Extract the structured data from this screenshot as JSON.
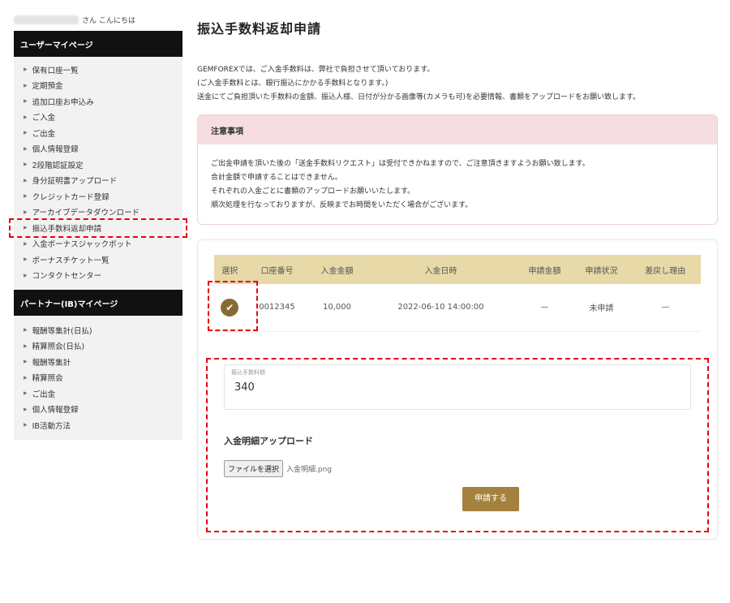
{
  "greeting": "さん こんにちは",
  "user_section": {
    "title": "ユーザーマイページ",
    "items": [
      "保有口座一覧",
      "定期預金",
      "追加口座お申込み",
      "ご入金",
      "ご出金",
      "個人情報登録",
      "2段階認証設定",
      "身分証明書アップロード",
      "クレジットカード登録",
      "アーカイブデータダウンロード",
      "振込手数料返却申請",
      "入金ボーナスジャックポット",
      "ボーナスチケット一覧",
      "コンタクトセンター"
    ]
  },
  "partner_section": {
    "title": "パートナー(IB)マイページ",
    "items": [
      "報酬等集計(日払)",
      "精算照会(日払)",
      "報酬等集計",
      "精算照会",
      "ご出金",
      "個人情報登録",
      "IB活動方法"
    ]
  },
  "page": {
    "title": "振込手数料返却申請",
    "intro": [
      "GEMFOREXでは、ご入金手数料は、弊社で負担させて頂いております。",
      "(ご入金手数料とは、銀行振込にかかる手数料となります。)",
      "送金にてご負担頂いた手数料の金額、振込人様、日付が分かる画像等(カメラも可)を必要情報、書類をアップロードをお願い致します。"
    ]
  },
  "notice": {
    "title": "注意事項",
    "lines": [
      "ご出金申請を頂いた後の「送金手数料リクエスト」は受付できかねますので、ご注意頂きますようお願い致します。",
      "合計金額で申請することはできません。",
      "それぞれの入金ごとに書類のアップロードお願いいたします。",
      "順次処理を行なっておりますが、反映までお時間をいただく場合がございます。"
    ]
  },
  "table": {
    "headers": [
      "選択",
      "口座番号",
      "入金金額",
      "入金日時",
      "申請金額",
      "申請状況",
      "差戻し理由"
    ],
    "row": {
      "account": "0012345",
      "amount": "10,000",
      "datetime": "2022-06-10 14:00:00",
      "request_amount": "—",
      "status": "未申請",
      "reason": "—"
    }
  },
  "form": {
    "fee_label": "振込手数料額",
    "fee_value": "340",
    "upload_title": "入金明細アップロード",
    "file_button": "ファイルを選択",
    "file_name": "入金明細.png",
    "submit_label": "申請する"
  },
  "colors": {
    "sidebar_header": "#111111",
    "highlight": "#e60012",
    "table_header": "#e8d9a8",
    "submit": "#a5813f",
    "notice_header": "#f5dde1"
  }
}
